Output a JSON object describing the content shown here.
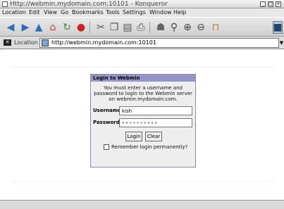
{
  "window": {
    "title": "Http://webmin.mydomain.com:10101 - Konqueror"
  },
  "menubar": {
    "items": [
      "Location",
      "Edit",
      "View",
      "Go",
      "Bookmarks",
      "Tools",
      "Settings",
      "Window",
      "Help"
    ]
  },
  "toolbar": {
    "buttons": [
      "back-icon",
      "forward-icon",
      "up-icon",
      "home-icon",
      "reload-icon",
      "stop-icon",
      "cut-icon",
      "copy-icon",
      "paste-icon",
      "print-icon",
      "security-icon",
      "find-icon",
      "zoom-in-icon",
      "zoom-out-icon",
      "lock-icon"
    ]
  },
  "location": {
    "label": "Location",
    "url": "http://webmin.mydomain.com:10101"
  },
  "login": {
    "title": "Login to Webmin",
    "message": "You must enter a username and password to login to the Webmin server on webmin.mydomain.com.",
    "username_label": "Username",
    "username_value": "kish",
    "password_label": "Password",
    "password_value": "••••••••••",
    "login_button": "Login",
    "clear_button": "Clear",
    "remember_label": "Remember login permanently?"
  },
  "colors": {
    "panel_header": "#9494c8",
    "panel_body": "#eeeeee",
    "chrome": "#d6d6d6"
  }
}
